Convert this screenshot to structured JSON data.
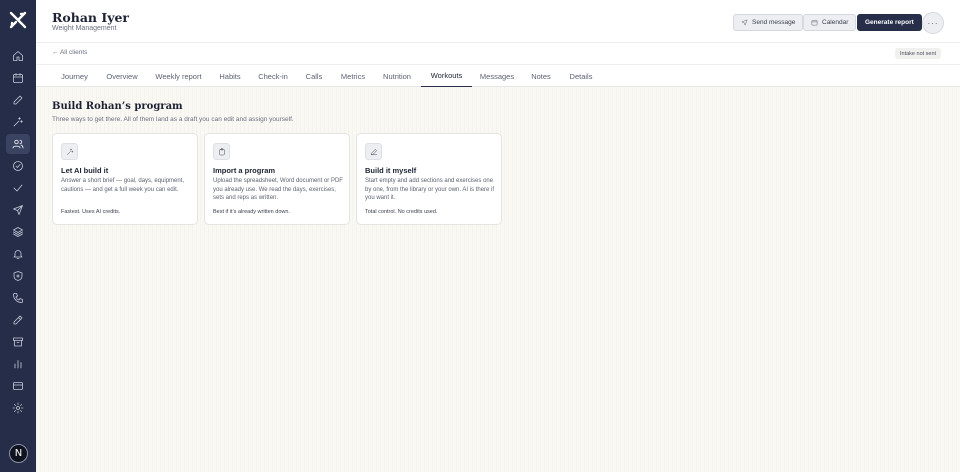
{
  "sidebar": {
    "icons": [
      "home-icon",
      "calendar-icon",
      "pencil-icon",
      "sparkle-icon",
      "users-icon",
      "check-circle-icon",
      "check-icon",
      "send-icon",
      "layers-icon",
      "bell-icon",
      "shield-icon",
      "phone-icon",
      "edit-icon",
      "archive-icon",
      "bar-chart-icon",
      "credit-card-icon",
      "gear-icon"
    ],
    "active": "users-icon",
    "avatar_initial": "N"
  },
  "header": {
    "client_name": "Rohan Iyer",
    "client_program": "Weight Management",
    "send_message_label": "Send message",
    "calendar_label": "Calendar",
    "generate_report_label": "Generate report",
    "more_label": "···"
  },
  "subbar": {
    "back_label": "← All clients",
    "intake_badge": "Intake not sent"
  },
  "tabs": [
    {
      "label": "Journey"
    },
    {
      "label": "Overview"
    },
    {
      "label": "Weekly report"
    },
    {
      "label": "Habits"
    },
    {
      "label": "Check-in"
    },
    {
      "label": "Calls"
    },
    {
      "label": "Metrics"
    },
    {
      "label": "Nutrition"
    },
    {
      "label": "Workouts",
      "active": true
    },
    {
      "label": "Messages"
    },
    {
      "label": "Notes"
    },
    {
      "label": "Details"
    }
  ],
  "main": {
    "title": "Build Rohan’s program",
    "subtitle": "Three ways to get there. All of them land as a draft you can edit and assign yourself.",
    "cards": [
      {
        "icon": "sparkle-icon",
        "title": "Let AI build it",
        "description": "Answer a short brief — goal, days, equipment, cautions — and get a full week you can edit.",
        "footer": "Fastest. Uses AI credits."
      },
      {
        "icon": "clipboard-icon",
        "title": "Import a program",
        "description": "Upload the spreadsheet, Word document or PDF you already use. We read the days, exercises, sets and reps as written.",
        "footer": "Best if it’s already written down."
      },
      {
        "icon": "pencil-icon",
        "title": "Build it myself",
        "description": "Start empty and add sections and exercises one by one, from the library or your own. AI is there if you want it.",
        "footer": "Total control. No credits used."
      }
    ]
  },
  "colors": {
    "sidebar_bg": "#252d48",
    "primary_button": "#262e4a",
    "page_bg": "#faf8f3"
  }
}
